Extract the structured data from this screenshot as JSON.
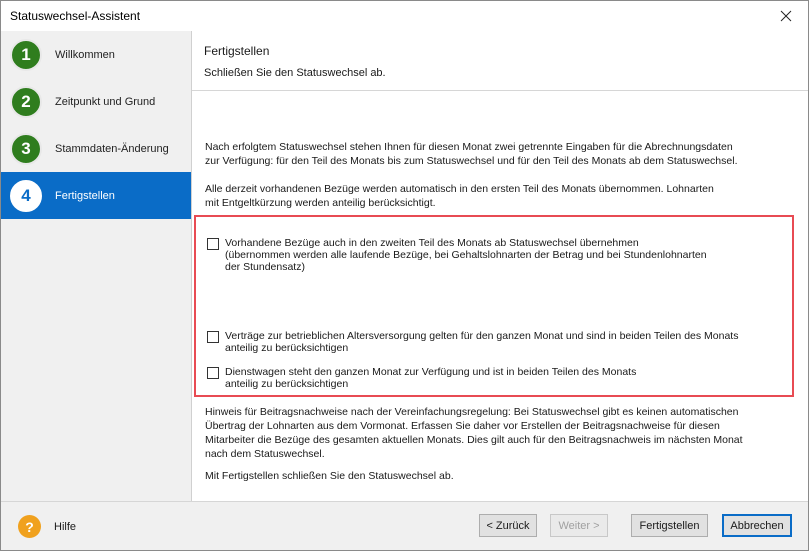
{
  "window": {
    "title": "Statuswechsel-Assistent",
    "close_label": "✕"
  },
  "sidebar": {
    "steps": [
      {
        "number": "1",
        "label": "Willkommen"
      },
      {
        "number": "2",
        "label": "Zeitpunkt und Grund"
      },
      {
        "number": "3",
        "label": "Stammdaten-Änderung"
      },
      {
        "number": "4",
        "label": "Fertigstellen"
      }
    ]
  },
  "main": {
    "heading": "Fertigstellen",
    "subheading": "Schließen Sie den Statuswechsel ab.",
    "para1_line1": "Nach erfolgtem Statuswechsel stehen Ihnen für diesen Monat zwei getrennte Eingaben für die Abrechnungsdaten",
    "para1_line2": "zur Verfügung: für den Teil des Monats bis zum Statuswechsel und für den Teil des Monats ab dem Statuswechsel.",
    "para2_line1": "Alle derzeit vorhandenen Bezüge werden automatisch in den ersten Teil des Monats übernommen. Lohnarten",
    "para2_line2": "mit Entgeltkürzung werden anteilig berücksichtigt.",
    "options": [
      {
        "line1": "Vorhandene Bezüge auch in den zweiten Teil des Monats ab Statuswechsel übernehmen",
        "line2": "(übernommen werden alle laufende Bezüge, bei Gehaltslohnarten der Betrag und bei Stundenlohnarten",
        "line3": "der Stundensatz)",
        "checked": false
      },
      {
        "line1": "Verträge zur betrieblichen Altersversorgung gelten für den ganzen Monat und sind in beiden Teilen des Monats",
        "line2": "anteilig zu berücksichtigen",
        "checked": false
      },
      {
        "line1": "Dienstwagen steht den ganzen Monat zur Verfügung und ist in beiden Teilen des Monats",
        "line2": "anteilig zu berücksichtigen",
        "checked": false
      }
    ],
    "note_line1": "Hinweis für Beitragsnachweise nach der Vereinfachungsregelung: Bei Statuswechsel gibt es keinen automatischen",
    "note_line2": "Übertrag der Lohnarten aus dem Vormonat. Erfassen Sie daher vor Erstellen der Beitragsnachweise für diesen",
    "note_line3": "Mitarbeiter die Bezüge des gesamten aktuellen Monats. Dies gilt auch für den Beitragsnachweis im nächsten Monat",
    "note_line4": "nach dem Statuswechsel.",
    "closing": "Mit Fertigstellen schließen Sie den Statuswechsel ab."
  },
  "footer": {
    "help_label": "Hilfe",
    "help_icon": "?",
    "back_label": "< Zurück",
    "next_label": "Weiter >",
    "finish_label": "Fertigstellen",
    "cancel_label": "Abbrechen"
  },
  "colors": {
    "step_done": "#2f7d1e",
    "step_active_bg": "#0a6cc7",
    "highlight_border": "#e84b53",
    "help_icon": "#f0a11e"
  }
}
